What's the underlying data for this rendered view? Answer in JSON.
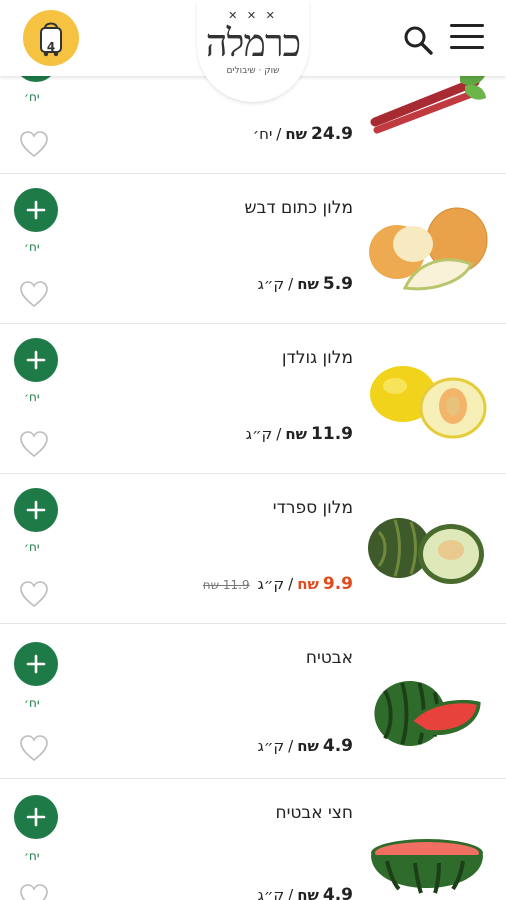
{
  "header": {
    "logo_text": "כרמלה",
    "logo_stars": "✕ ✕ ✕",
    "logo_sub": "שוק · שיבולים",
    "cart_count": "4",
    "icons": {
      "cart": "cart-icon",
      "search": "search-icon",
      "menu": "hamburger-menu-icon"
    }
  },
  "products": [
    {
      "name": "",
      "price": "24.9",
      "currency": "שח",
      "unit": "יח׳",
      "old_price": "",
      "on_sale": false,
      "add_unit": "יח׳",
      "image": "rhubarb"
    },
    {
      "name": "מלון כתום דבש",
      "price": "5.9",
      "currency": "שח",
      "unit": "ק״ג",
      "old_price": "",
      "on_sale": false,
      "add_unit": "יח׳",
      "image": "orange-honey-melon"
    },
    {
      "name": "מלון גולדן",
      "price": "11.9",
      "currency": "שח",
      "unit": "ק״ג",
      "old_price": "",
      "on_sale": false,
      "add_unit": "יח׳",
      "image": "golden-melon"
    },
    {
      "name": "מלון ספרדי",
      "price": "9.9",
      "currency": "שח",
      "unit": "ק״ג",
      "old_price": "11.9 שח",
      "on_sale": true,
      "add_unit": "יח׳",
      "image": "spanish-melon"
    },
    {
      "name": "אבטיח",
      "price": "4.9",
      "currency": "שח",
      "unit": "ק״ג",
      "old_price": "",
      "on_sale": false,
      "add_unit": "יח׳",
      "image": "watermelon"
    },
    {
      "name": "חצי אבטיח",
      "price": "4.9",
      "currency": "שח",
      "unit": "ק״ג",
      "old_price": "",
      "on_sale": false,
      "add_unit": "יח׳",
      "image": "half-watermelon"
    }
  ],
  "colors": {
    "accent_green": "#1e7a47",
    "cart_yellow": "#f5c242",
    "sale_red": "#e14a1c"
  }
}
